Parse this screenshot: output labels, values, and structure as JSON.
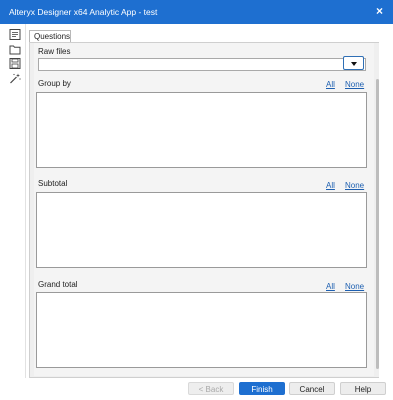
{
  "window": {
    "title": "Alteryx Designer x64 Analytic App - test",
    "close_glyph": "×",
    "accent_color": "#1e6fd0"
  },
  "sidebar": {
    "icons": [
      "questions-icon",
      "folder-icon",
      "save-icon",
      "magic-wand-icon"
    ]
  },
  "tabs": [
    {
      "label": "Questions"
    }
  ],
  "form": {
    "raw_files": {
      "label": "Raw files",
      "value": ""
    },
    "group_by": {
      "label": "Group by",
      "all": "All",
      "none": "None"
    },
    "subtotal": {
      "label": "Subtotal",
      "all": "All",
      "none": "None"
    },
    "grand_total": {
      "label": "Grand total",
      "all": "All",
      "none": "None"
    }
  },
  "buttons": {
    "back": "< Back",
    "finish": "Finish",
    "cancel": "Cancel",
    "help": "Help"
  }
}
